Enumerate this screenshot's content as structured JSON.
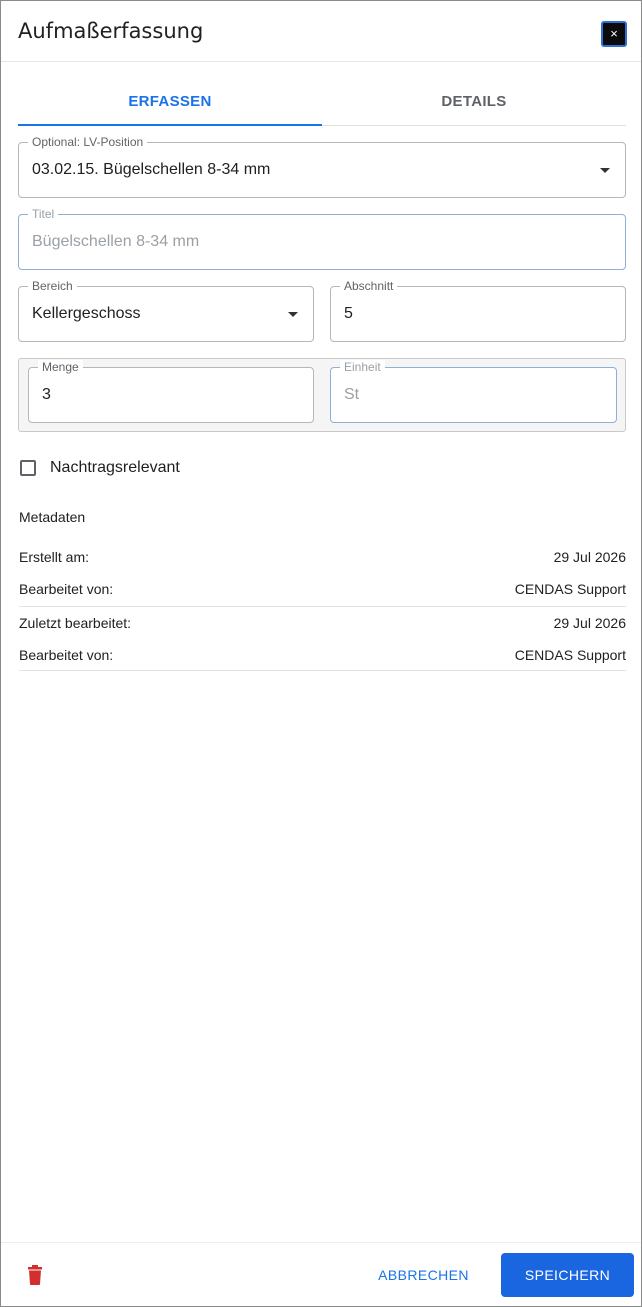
{
  "dialog": {
    "title": "Aufmaßerfassung",
    "close_label": "×"
  },
  "tabs": [
    {
      "label": "ERFASSEN",
      "active": true
    },
    {
      "label": "DETAILS",
      "active": false
    }
  ],
  "form": {
    "lv_position": {
      "label": "Optional: LV-Position",
      "value": "03.02.15. Bügelschellen 8-34 mm"
    },
    "titel": {
      "label": "Titel",
      "value": "Bügelschellen 8-34 mm"
    },
    "bereich": {
      "label": "Bereich",
      "value": "Kellergeschoss"
    },
    "abschnitt": {
      "label": "Abschnitt",
      "value": "5"
    },
    "menge": {
      "label": "Menge",
      "value": "3"
    },
    "einheit": {
      "label": "Einheit",
      "value": "St"
    },
    "nachtragsrelevant": {
      "label": "Nachtragsrelevant",
      "checked": false
    }
  },
  "metadata": {
    "heading": "Metadaten",
    "rows": [
      {
        "key": "Erstellt am:",
        "value": "29 Jul 2026"
      },
      {
        "key": "Bearbeitet von:",
        "value": "CENDAS Support"
      },
      {
        "key": "Zuletzt bearbeitet:",
        "value": "29 Jul 2026"
      },
      {
        "key": "Bearbeitet von:",
        "value": "CENDAS Support"
      }
    ]
  },
  "footer": {
    "cancel_label": "ABBRECHEN",
    "save_label": "SPEICHERN",
    "delete_icon": "trash-icon"
  },
  "colors": {
    "accent": "#1a73e8",
    "primary_button": "#1a66e0",
    "delete": "#d32f2f"
  }
}
